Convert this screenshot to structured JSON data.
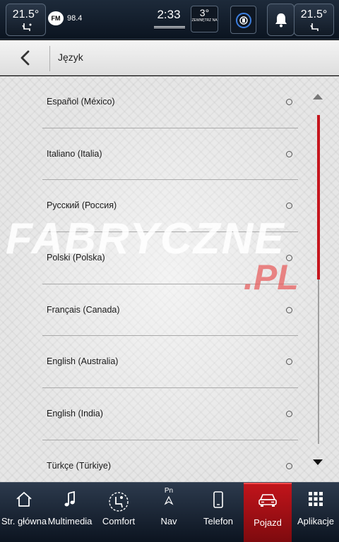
{
  "status_bar": {
    "climate_left_temp": "21.5°",
    "radio_band": "FM",
    "radio_frequency": "98.4",
    "time": "2:33",
    "outside_temp": "3°",
    "outside_label": "ZEWNĘTRZ NA",
    "climate_right_temp": "21.5°"
  },
  "header": {
    "title": "Język"
  },
  "languages": [
    {
      "label": "Español (México)",
      "selected": false
    },
    {
      "label": "Italiano (Italia)",
      "selected": false
    },
    {
      "label": "Русский (Россия)",
      "selected": false
    },
    {
      "label": "Polski (Polska)",
      "selected": false
    },
    {
      "label": "Français (Canada)",
      "selected": false
    },
    {
      "label": "English (Australia)",
      "selected": false
    },
    {
      "label": "English (India)",
      "selected": false
    },
    {
      "label": "Türkçe (Türkiye)",
      "selected": false
    }
  ],
  "watermark": {
    "main": "FABRYCZNE",
    "suffix": ".PL"
  },
  "scroll": {
    "position_fraction": 0.0,
    "visible_fraction": 0.5
  },
  "nav": [
    {
      "label": "Str. główna",
      "icon": "home-icon",
      "active": false
    },
    {
      "label": "Multimedia",
      "icon": "music-note-icon",
      "active": false
    },
    {
      "label": "Comfort",
      "icon": "comfort-seat-icon",
      "active": false
    },
    {
      "label": "Nav",
      "icon": "nav-arrow-icon",
      "sublabel": "Pn",
      "active": false
    },
    {
      "label": "Telefon",
      "icon": "phone-icon",
      "active": false
    },
    {
      "label": "Pojazd",
      "icon": "car-icon",
      "active": true
    },
    {
      "label": "Aplikacje",
      "icon": "apps-grid-icon",
      "active": false
    }
  ],
  "colors": {
    "accent": "#c1141b",
    "scroll_thumb": "#c5151d"
  }
}
